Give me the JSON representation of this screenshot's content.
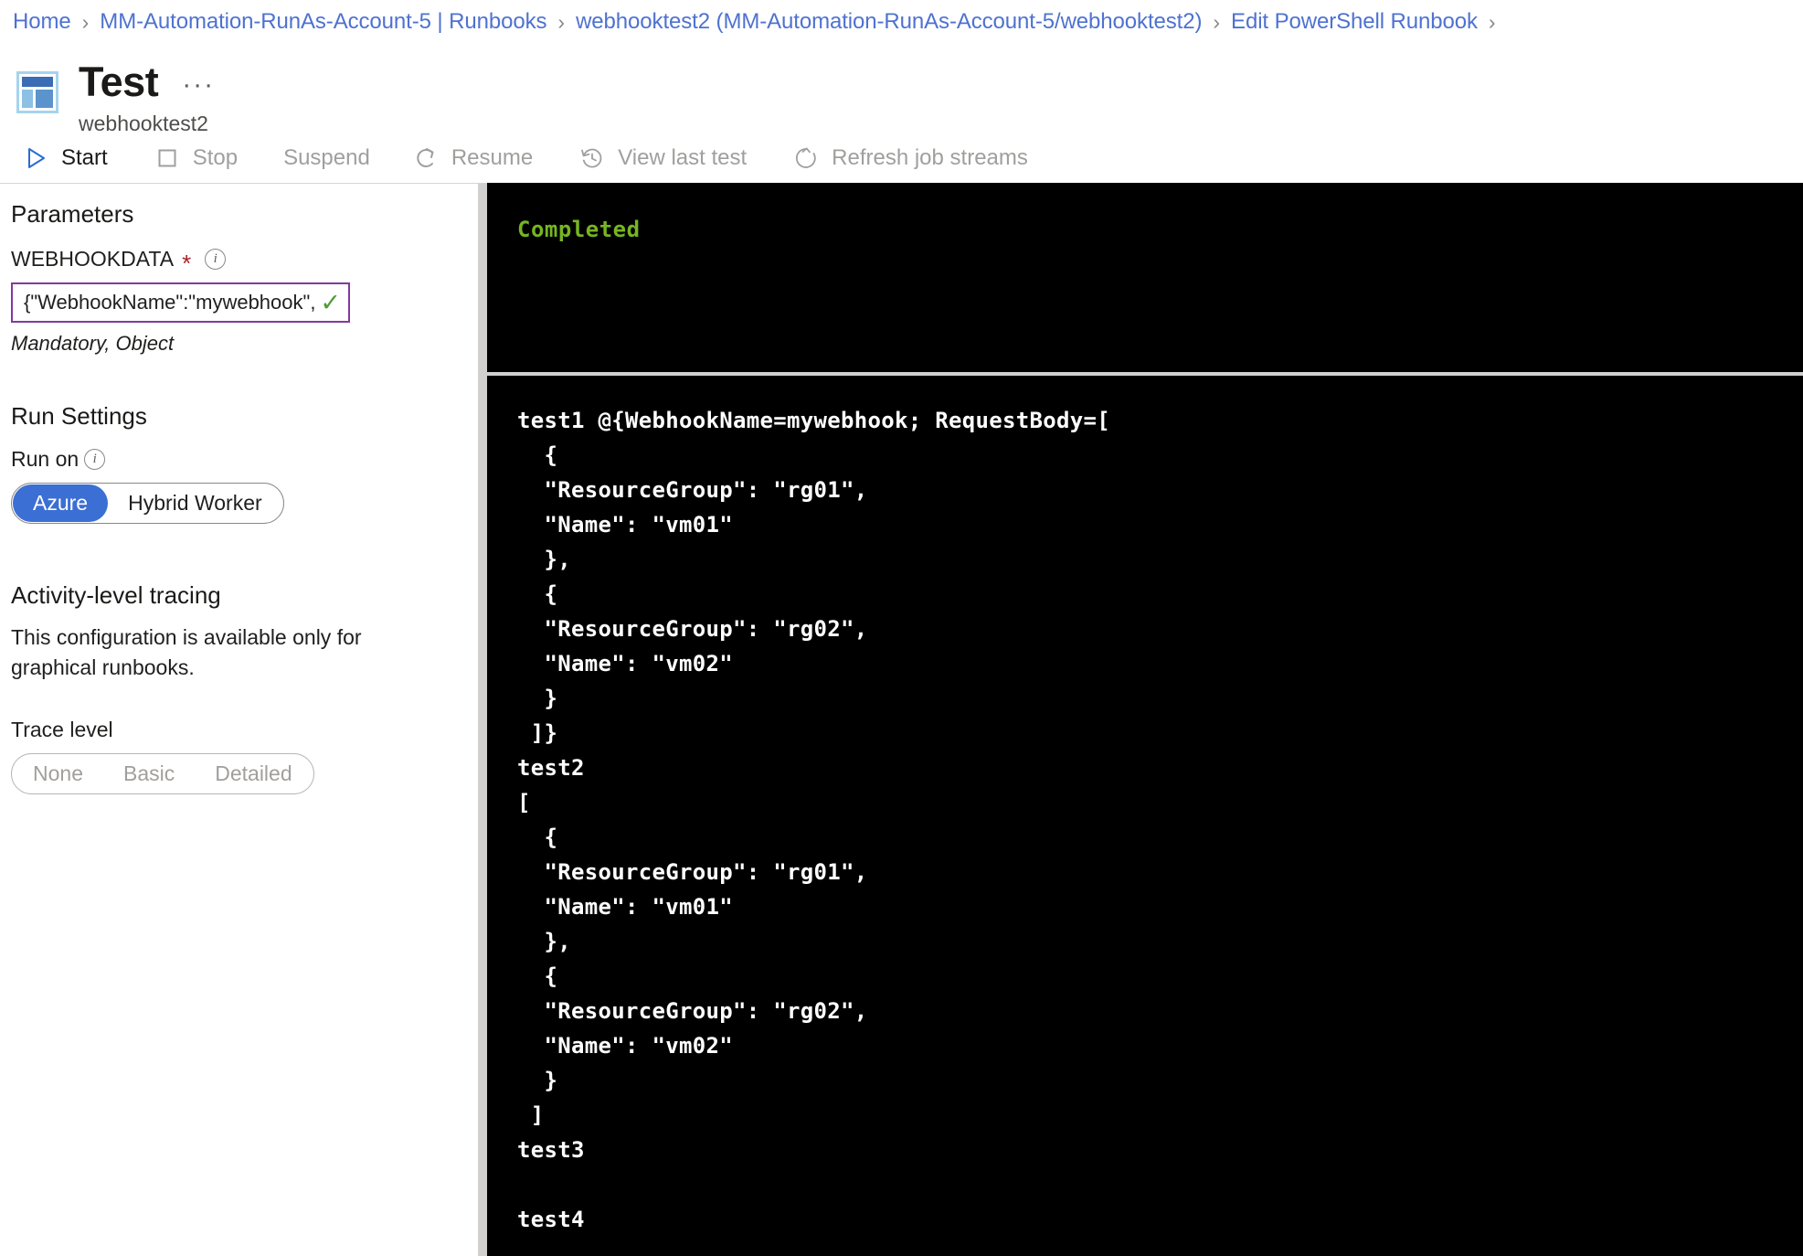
{
  "breadcrumb": {
    "separator": "›",
    "items": [
      "Home",
      "MM-Automation-RunAs-Account-5 | Runbooks",
      "webhooktest2 (MM-Automation-RunAs-Account-5/webhooktest2)",
      "Edit PowerShell Runbook"
    ]
  },
  "header": {
    "title": "Test",
    "subtitle": "webhooktest2",
    "ellipsis": "···"
  },
  "toolbar": {
    "start": "Start",
    "stop": "Stop",
    "suspend": "Suspend",
    "resume": "Resume",
    "view_last_test": "View last test",
    "refresh_job_streams": "Refresh job streams"
  },
  "parameters": {
    "section_title": "Parameters",
    "field_label": "WEBHOOKDATA",
    "required_marker": "*",
    "value": "{\"WebhookName\":\"mywebhook\",\"...",
    "placeholder": "{\"WebhookName\":\"mywebhook\",\"...",
    "valid_check": "✓",
    "hint": "Mandatory, Object"
  },
  "run_settings": {
    "section_title": "Run Settings",
    "run_on_label": "Run on",
    "options": [
      "Azure",
      "Hybrid Worker"
    ],
    "selected": "Azure"
  },
  "tracing": {
    "section_title": "Activity-level tracing",
    "description": "This configuration is available only for graphical runbooks.",
    "trace_level_label": "Trace level",
    "trace_options": [
      "None",
      "Basic",
      "Detailed"
    ],
    "trace_selected": null
  },
  "console": {
    "status": "Completed",
    "status_color": "#76b521",
    "lines": [
      "test1 @{WebhookName=mywebhook; RequestBody=[",
      "  {",
      "  \"ResourceGroup\": \"rg01\",",
      "  \"Name\": \"vm01\"",
      "  },",
      "  {",
      "  \"ResourceGroup\": \"rg02\",",
      "  \"Name\": \"vm02\"",
      "  }",
      " ]}",
      "test2",
      "[",
      "  {",
      "  \"ResourceGroup\": \"rg01\",",
      "  \"Name\": \"vm01\"",
      "  },",
      "  {",
      "  \"ResourceGroup\": \"rg02\",",
      "  \"Name\": \"vm02\"",
      "  }",
      " ]",
      "test3",
      "",
      "test4"
    ]
  },
  "colors": {
    "link": "#4e72d0",
    "accent": "#3b6fd4",
    "input_border": "#8338a0",
    "required": "#a4262c",
    "success": "#4f9a37",
    "console_green": "#76b521"
  }
}
